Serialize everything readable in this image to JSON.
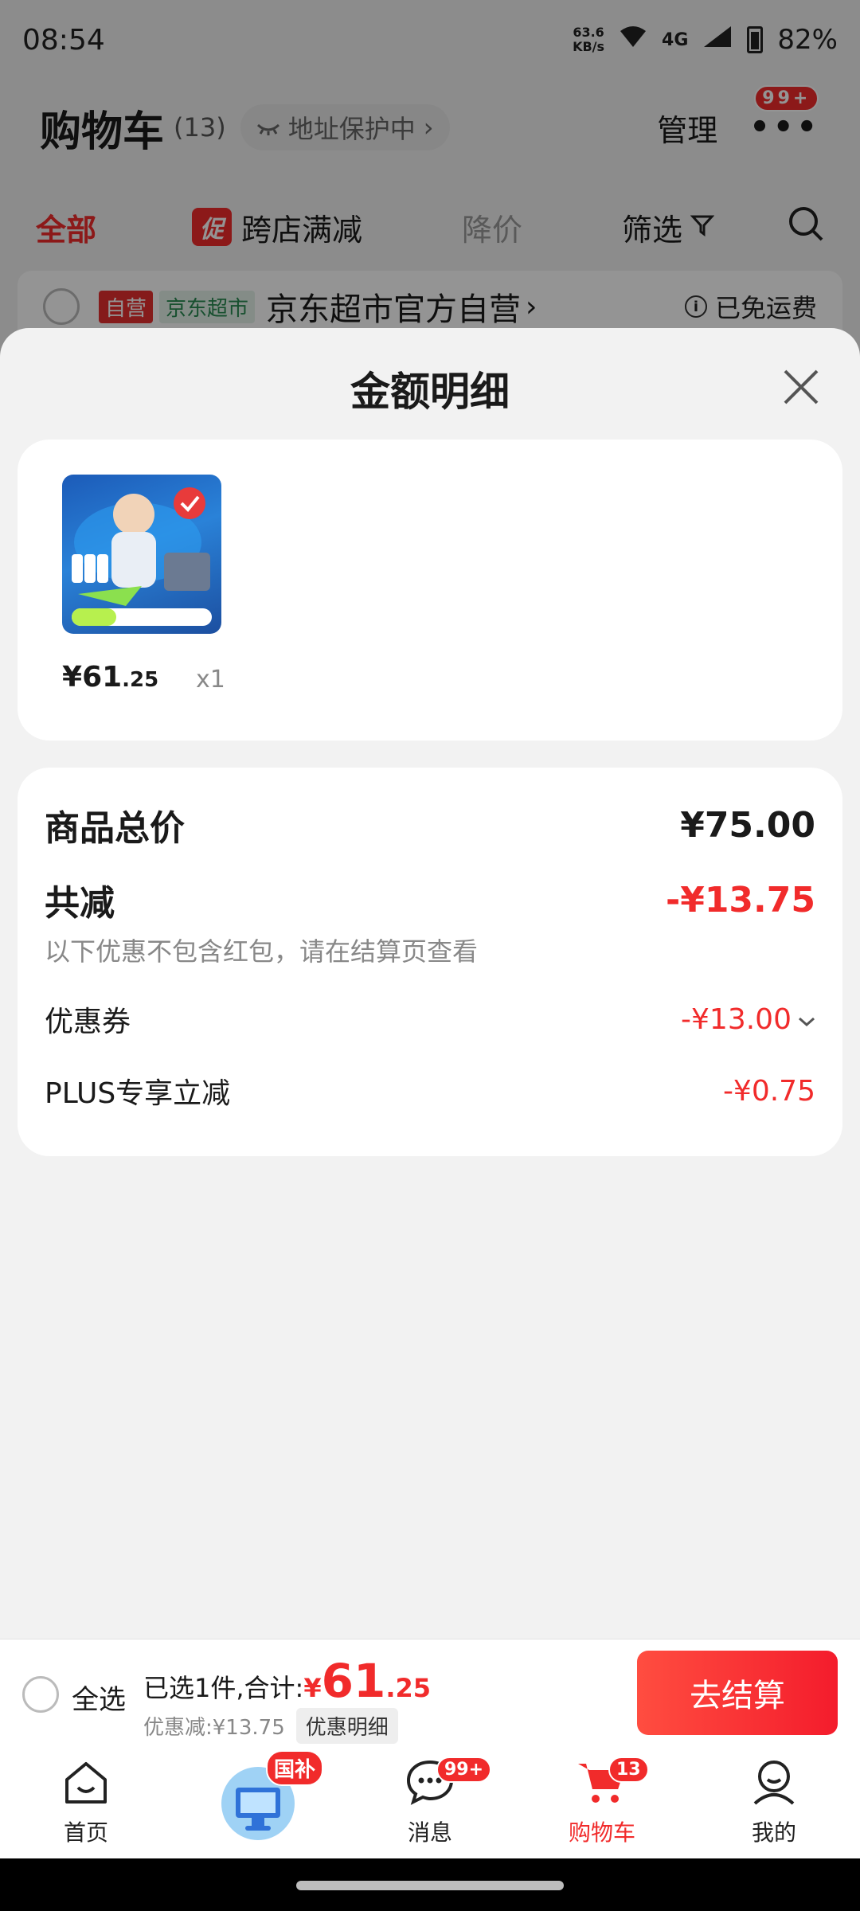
{
  "status_bar": {
    "time": "08:54",
    "net_speed_value": "63.6",
    "net_speed_unit": "KB/s",
    "network": "4G",
    "battery": "82%"
  },
  "cart_header": {
    "title": "购物车",
    "count": "(13)",
    "address_protect": "地址保护中",
    "manage": "管理",
    "more_badge": "99+"
  },
  "filters": {
    "all": "全部",
    "promo_tag": "促",
    "cross_store": "跨店满减",
    "price_drop": "降价",
    "filter": "筛选"
  },
  "store": {
    "tag_self": "自营",
    "tag_jd": "京东超市",
    "name": "京东超市官方自营",
    "shipping": "已免运费"
  },
  "sheet": {
    "title": "金额明细",
    "product": {
      "price_currency": "¥",
      "price_int": "61",
      "price_dec": ".25",
      "quantity": "x1"
    },
    "summary": {
      "total_label": "商品总价",
      "total_value": "¥75.00",
      "reduce_label": "共减",
      "reduce_value": "-¥13.75",
      "note": "以下优惠不包含红包，请在结算页查看",
      "coupon_label": "优惠券",
      "coupon_value": "-¥13.00",
      "plus_label": "PLUS专享立减",
      "plus_value": "-¥0.75"
    }
  },
  "checkout": {
    "select_all": "全选",
    "selected_text": "已选1件,合计:",
    "currency": "¥",
    "total_int": "61",
    "total_dec": ".25",
    "discount_text": "优惠减:¥13.75",
    "detail_button": "优惠明细",
    "submit": "去结算"
  },
  "tabbar": {
    "home": "首页",
    "guobu_badge": "国补",
    "messages": "消息",
    "messages_badge": "99+",
    "cart": "购物车",
    "cart_badge": "13",
    "mine": "我的"
  },
  "colors": {
    "accent_red": "#f12b2b",
    "sheet_bg": "#f2f2f2"
  }
}
